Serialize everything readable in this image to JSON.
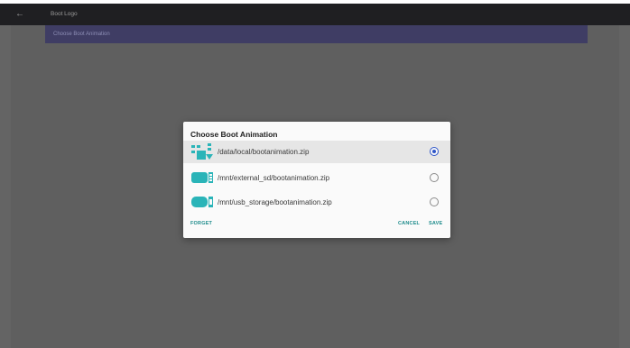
{
  "topbar": {
    "back_icon": "arrow-left-icon",
    "title": "Boot Logo"
  },
  "background": {
    "selected_item_label": "Choose Boot Animation"
  },
  "dialog": {
    "title": "Choose Boot Animation",
    "options": [
      {
        "label": "/data/local/bootanimation.zip",
        "icon": "internal-storage-icon",
        "selected": true
      },
      {
        "label": "/mnt/external_sd/bootanimation.zip",
        "icon": "sd-card-icon",
        "selected": false
      },
      {
        "label": "/mnt/usb_storage/bootanimation.zip",
        "icon": "usb-storage-icon",
        "selected": false
      }
    ],
    "buttons": {
      "forget": "FORGET",
      "cancel": "CANCEL",
      "save": "SAVE"
    }
  },
  "colors": {
    "accent": "#1e8c8c",
    "radio_selected": "#2f56c8",
    "icon_teal": "#2ab4b8",
    "highlight_bar": "#3f3d64"
  }
}
